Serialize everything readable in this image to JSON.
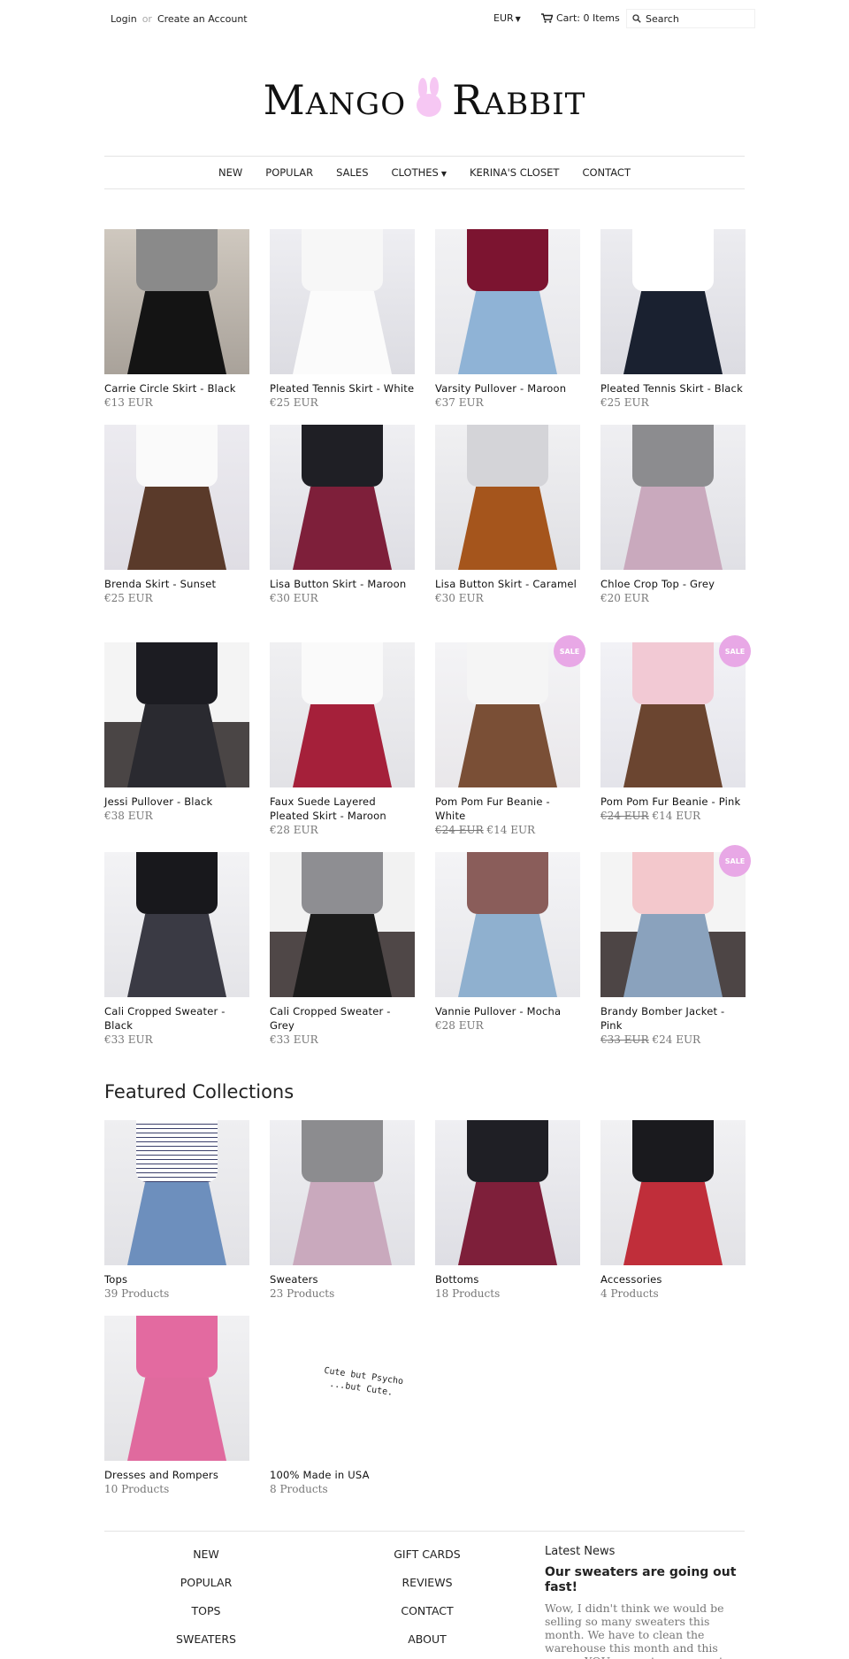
{
  "header": {
    "login": "Login",
    "or": "or",
    "create_account": "Create an Account",
    "currency": "EUR",
    "cart": "Cart: 0 Items",
    "search_placeholder": "Search"
  },
  "logo": {
    "word1_first": "M",
    "word1_rest": "ANGO",
    "word2_first": "R",
    "word2_rest": "ABBIT",
    "bunny_color": "#f6c7f3"
  },
  "nav": [
    "NEW",
    "POPULAR",
    "SALES",
    "CLOTHES",
    "KERINA'S CLOSET",
    "CONTACT"
  ],
  "products": [
    {
      "name": "Carrie Circle Skirt - Black",
      "price": "€13 EUR",
      "img": "pale-stone"
    },
    {
      "name": "Pleated Tennis Skirt - White",
      "price": "€25 EUR",
      "img": "white"
    },
    {
      "name": "Varsity Pullover - Maroon",
      "price": "€37 EUR",
      "img": "maroon"
    },
    {
      "name": "Pleated Tennis Skirt - Black",
      "price": "€25 EUR",
      "img": "navy"
    },
    {
      "name": "Brenda Skirt - Sunset",
      "price": "€25 EUR",
      "img": "plaid"
    },
    {
      "name": "Lisa Button Skirt - Maroon",
      "price": "€30 EUR",
      "img": "maroon-suede"
    },
    {
      "name": "Lisa Button Skirt - Caramel",
      "price": "€30 EUR",
      "img": "caramel"
    },
    {
      "name": "Chloe Crop Top - Grey",
      "price": "€20 EUR",
      "img": "grey"
    },
    {
      "name": "Jessi Pullover - Black",
      "price": "€38 EUR",
      "img": "room-dark"
    },
    {
      "name": "Faux Suede Layered Pleated Skirt - Maroon",
      "price": "€28 EUR",
      "img": "red-pleat"
    },
    {
      "name": "Pom Pom Fur Beanie - White",
      "old_price": "€24 EUR",
      "price": "€14 EUR",
      "sale": "SALE",
      "img": "beanie-white"
    },
    {
      "name": "Pom Pom Fur Beanie - Pink",
      "old_price": "€24 EUR",
      "price": "€14 EUR",
      "sale": "SALE",
      "img": "beanie-pink"
    },
    {
      "name": "Cali Cropped Sweater - Black",
      "price": "€33 EUR",
      "img": "black-plaid"
    },
    {
      "name": "Cali Cropped Sweater - Grey",
      "price": "€33 EUR",
      "img": "room-grey"
    },
    {
      "name": "Vannie Pullover - Mocha",
      "price": "€28 EUR",
      "img": "mocha"
    },
    {
      "name": "Brandy Bomber Jacket - Pink",
      "old_price": "€33 EUR",
      "price": "€24 EUR",
      "sale": "SALE",
      "img": "room-pink"
    }
  ],
  "featured": {
    "title": "Featured Collections",
    "items": [
      {
        "name": "Tops",
        "count": "39 Products",
        "img": "stripes"
      },
      {
        "name": "Sweaters",
        "count": "23 Products",
        "img": "grey"
      },
      {
        "name": "Bottoms",
        "count": "18 Products",
        "img": "maroon-suede"
      },
      {
        "name": "Accessories",
        "count": "4 Products",
        "img": "accessories"
      },
      {
        "name": "Dresses and Rompers",
        "count": "10 Products",
        "img": "pink-dress"
      },
      {
        "name": "100% Made in USA",
        "count": "8 Products",
        "img": "tee",
        "shirt_text_1": "Cute but Psycho",
        "shirt_text_2": "...but Cute."
      }
    ]
  },
  "footer": {
    "col1": [
      "NEW",
      "POPULAR",
      "TOPS",
      "SWEATERS"
    ],
    "col2": [
      "GIFT CARDS",
      "REVIEWS",
      "CONTACT",
      "ABOUT"
    ],
    "news_heading": "Latest News",
    "news_title": "Our sweaters are going out fast!",
    "news_body": "Wow, I didn't think we would be selling so many sweaters this month.  We have to clean the warehouse this month and this means YOU can get on on great"
  }
}
